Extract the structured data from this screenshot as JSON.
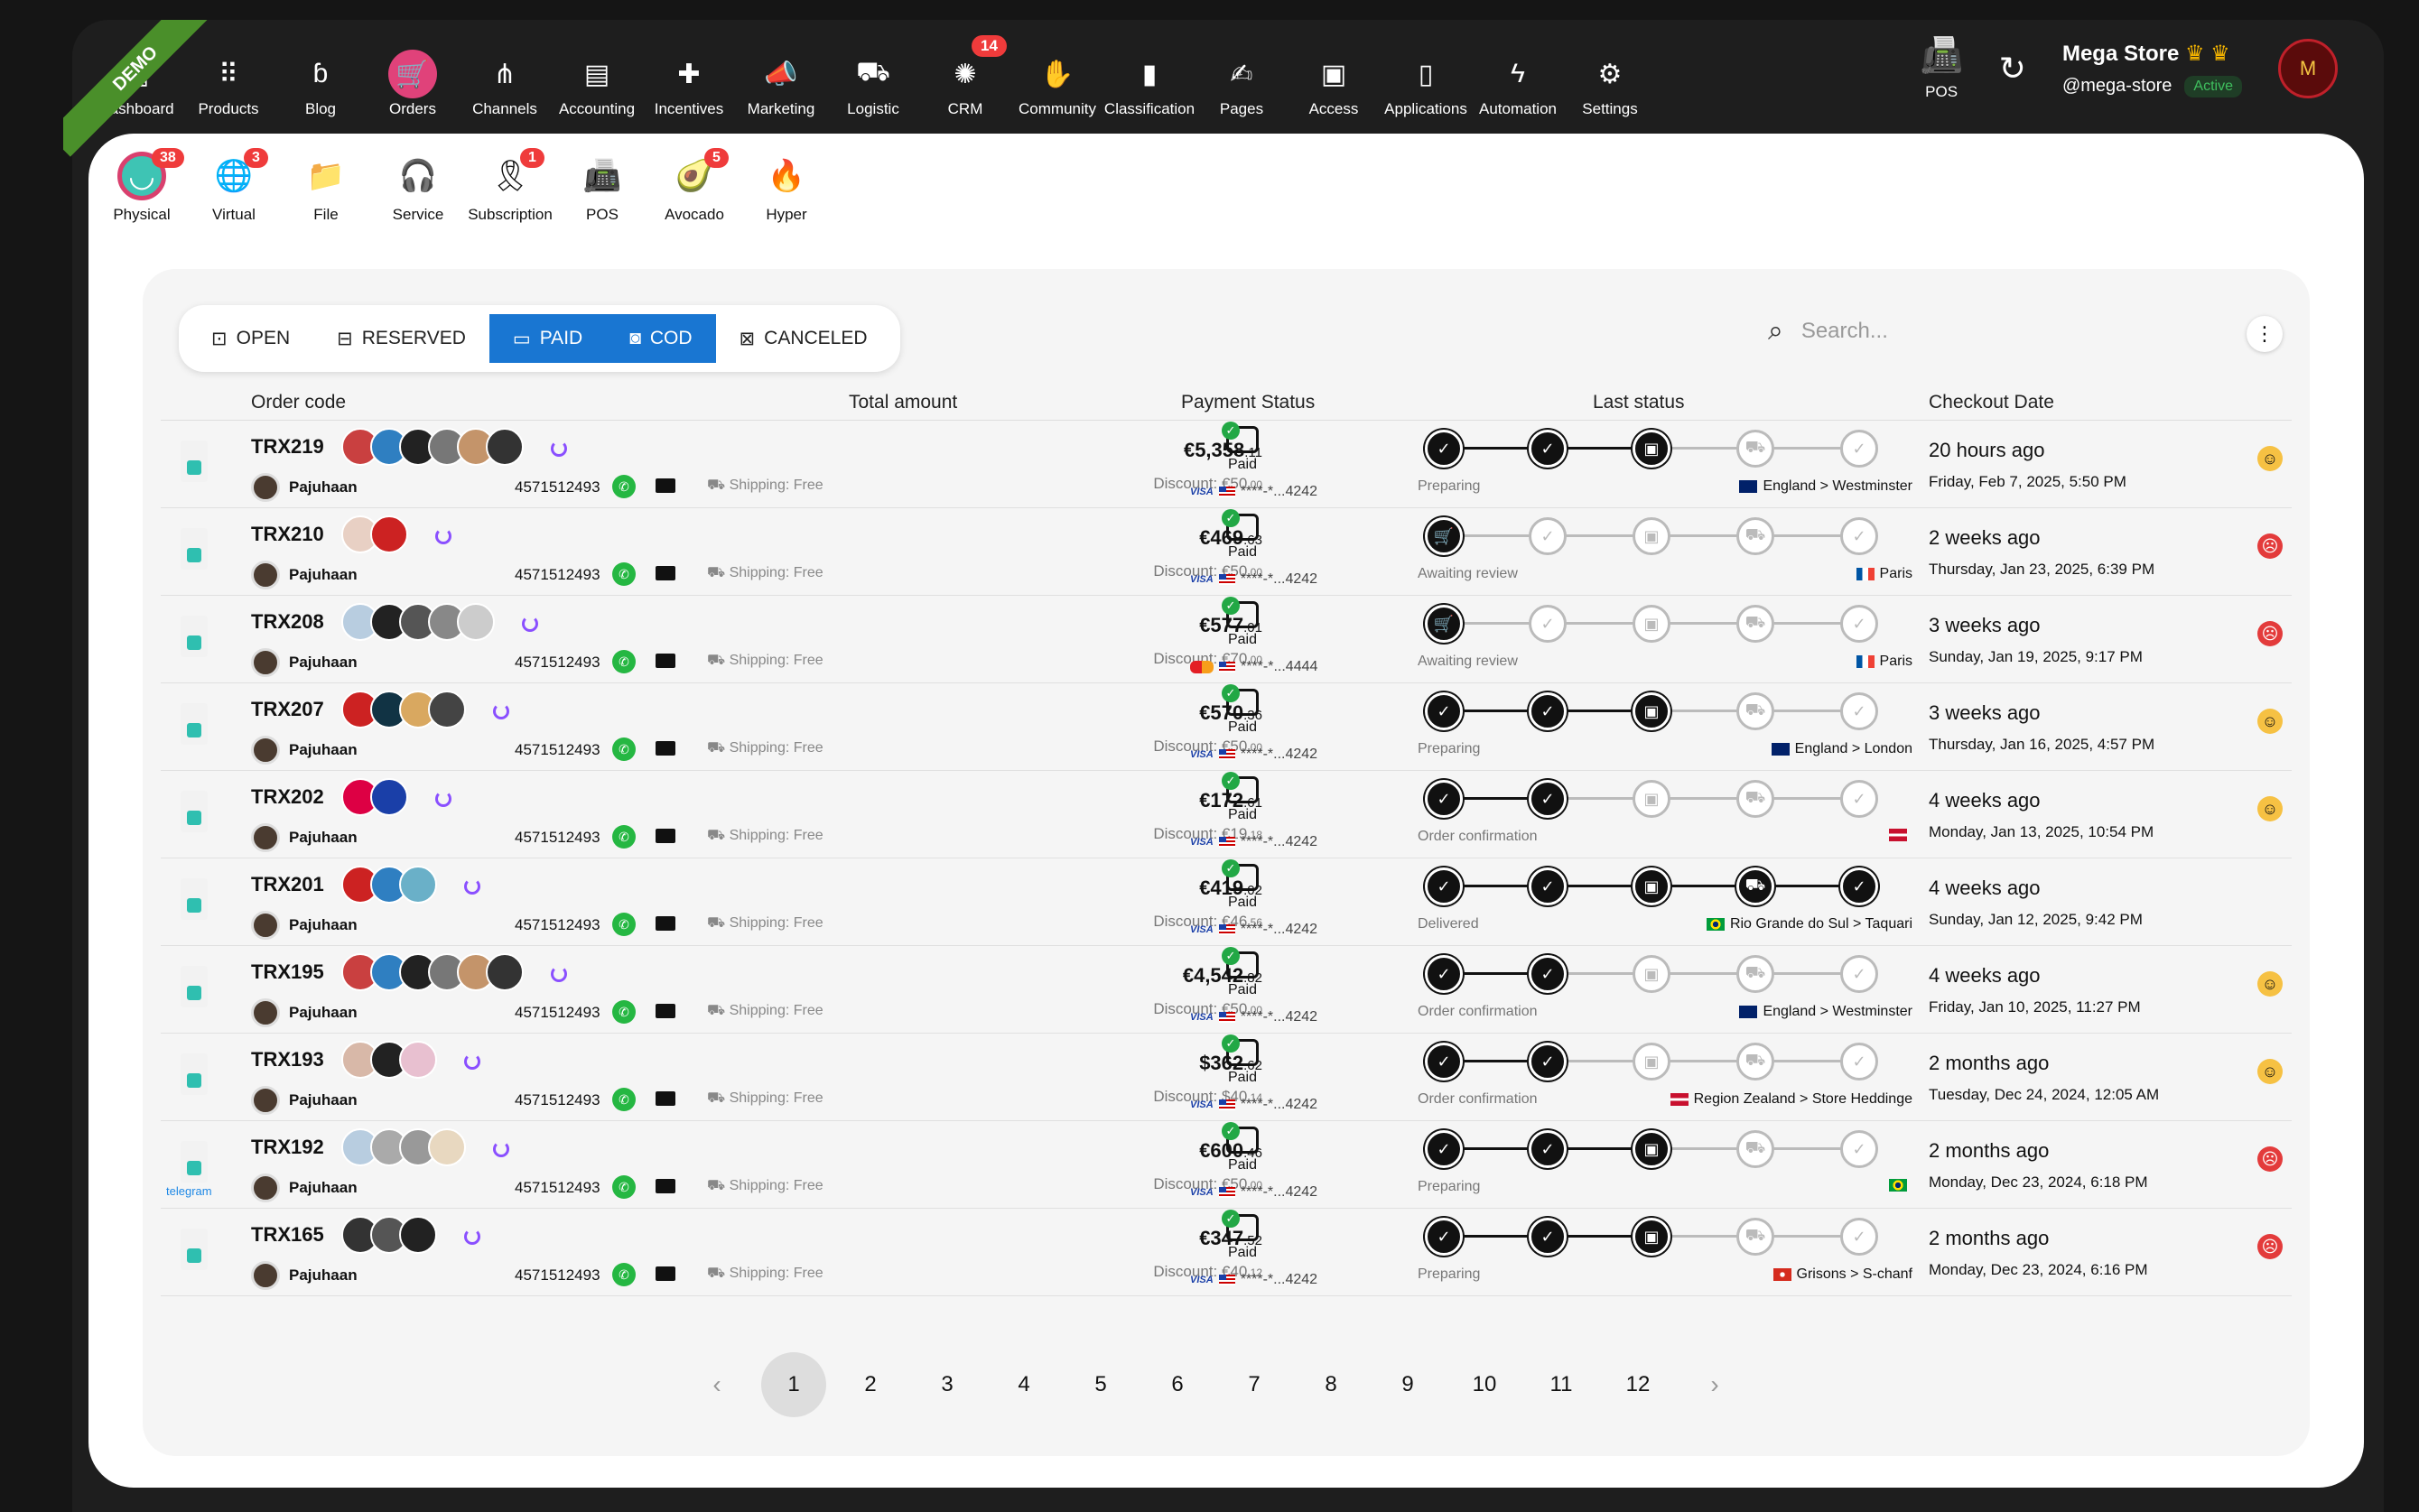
{
  "topnav": [
    {
      "label": "Dashboard",
      "icon": "dashboard-icon",
      "glyph": "▦"
    },
    {
      "label": "Products",
      "icon": "products-icon",
      "glyph": "⠿"
    },
    {
      "label": "Blog",
      "icon": "blog-icon",
      "glyph": "ɓ"
    },
    {
      "label": "Orders",
      "icon": "cart-icon",
      "glyph": "🛒",
      "active": true
    },
    {
      "label": "Channels",
      "icon": "channels-icon",
      "glyph": "⋔"
    },
    {
      "label": "Accounting",
      "icon": "register-icon",
      "glyph": "▤"
    },
    {
      "label": "Incentives",
      "icon": "ticket-icon",
      "glyph": "✚"
    },
    {
      "label": "Marketing",
      "icon": "megaphone-icon",
      "glyph": "📣"
    },
    {
      "label": "Logistic",
      "icon": "truck-icon",
      "glyph": "⛟"
    },
    {
      "label": "CRM",
      "icon": "crm-icon",
      "glyph": "✺",
      "badge": "14"
    },
    {
      "label": "Community",
      "icon": "community-icon",
      "glyph": "✋"
    },
    {
      "label": "Classification",
      "icon": "book-icon",
      "glyph": "▮"
    },
    {
      "label": "Pages",
      "icon": "pages-icon",
      "glyph": "✍"
    },
    {
      "label": "Access",
      "icon": "badge-icon",
      "glyph": "▣"
    },
    {
      "label": "Applications",
      "icon": "phone-icon",
      "glyph": "▯"
    },
    {
      "label": "Automation",
      "icon": "bolt-icon",
      "glyph": "ϟ"
    },
    {
      "label": "Settings",
      "icon": "gear-icon",
      "glyph": "⚙"
    }
  ],
  "ribbon": "DEMO",
  "right": {
    "pos_label": "POS",
    "store_name": "Mega Store",
    "handle": "@mega-store",
    "status": "Active",
    "avatar": "M"
  },
  "subnav": [
    {
      "label": "Physical",
      "icon": "bag-icon",
      "glyph": "◡",
      "badge": "38",
      "active": true
    },
    {
      "label": "Virtual",
      "icon": "globe-icon",
      "glyph": "🌐",
      "badge": "3"
    },
    {
      "label": "File",
      "icon": "folder-icon",
      "glyph": "📁"
    },
    {
      "label": "Service",
      "icon": "headset-icon",
      "glyph": "🎧"
    },
    {
      "label": "Subscription",
      "icon": "ribbon-icon",
      "glyph": "🎗",
      "badge": "1"
    },
    {
      "label": "POS",
      "icon": "pos-icon",
      "glyph": "📠"
    },
    {
      "label": "Avocado",
      "icon": "avocado-icon",
      "glyph": "🥑",
      "badge": "5"
    },
    {
      "label": "Hyper",
      "icon": "flame-icon",
      "glyph": "🔥"
    }
  ],
  "tabs": [
    {
      "label": "OPEN",
      "glyph": "⊡",
      "sel": false
    },
    {
      "label": "RESERVED",
      "glyph": "⊟",
      "sel": false
    },
    {
      "label": "PAID",
      "glyph": "▭",
      "sel": true
    },
    {
      "label": "COD",
      "glyph": "◙",
      "sel": true
    },
    {
      "label": "CANCELED",
      "glyph": "⊠",
      "sel": false
    }
  ],
  "search_placeholder": "Search...",
  "headers": {
    "code": "Order code",
    "total": "Total amount",
    "payment": "Payment Status",
    "last": "Last status",
    "date": "Checkout Date"
  },
  "colors": {
    "accent": "#1976d2",
    "orders": "#e0427a",
    "badge": "#ef3b3b"
  },
  "orders": [
    {
      "code": "TRX219",
      "thumbs": [
        "#c94040",
        "#2f7fc1",
        "#222",
        "#777",
        "#c4946a",
        "#333"
      ],
      "customer": "Pajuhaan",
      "phone": "4571512493",
      "shipping": "Shipping: Free",
      "amount": "€5,358",
      "cents": ".11",
      "discount": "Discount: €50",
      "dcents": ".00",
      "paid": "Paid",
      "card": "mc0",
      "cardtext": "****-*...4242",
      "steps": 3,
      "label": "Preparing",
      "flag": "uk",
      "loc": "England > Westminster",
      "ago": "20 hours ago",
      "date": "Friday, Feb 7, 2025, 5:50 PM",
      "face": "ok"
    },
    {
      "code": "TRX210",
      "thumbs": [
        "#e8d0c4",
        "#c22"
      ],
      "customer": "Pajuhaan",
      "phone": "4571512493",
      "shipping": "Shipping: Free",
      "amount": "€469",
      "cents": ".63",
      "discount": "Discount: €50",
      "dcents": ".00",
      "paid": "Paid",
      "card": "visa",
      "cardtext": "****-*...4242",
      "steps": 1,
      "label": "Awaiting review",
      "flag": "fr",
      "loc": "Paris",
      "ago": "2 weeks ago",
      "date": "Thursday, Jan 23, 2025, 6:39 PM",
      "face": "bad"
    },
    {
      "code": "TRX208",
      "thumbs": [
        "#b8cde0",
        "#222",
        "#555",
        "#888",
        "#ccc"
      ],
      "customer": "Pajuhaan",
      "phone": "4571512493",
      "shipping": "Shipping: Free",
      "amount": "€577",
      "cents": ".01",
      "discount": "Discount: €70",
      "dcents": ".00",
      "paid": "Paid",
      "card": "mc",
      "cardtext": "****-*...4444",
      "steps": 1,
      "label": "Awaiting review",
      "flag": "fr",
      "loc": "Paris",
      "ago": "3 weeks ago",
      "date": "Sunday, Jan 19, 2025, 9:17 PM",
      "face": "bad"
    },
    {
      "code": "TRX207",
      "thumbs": [
        "#c22",
        "#134",
        "#d9a860",
        "#444"
      ],
      "customer": "Pajuhaan",
      "phone": "4571512493",
      "shipping": "Shipping: Free",
      "amount": "€570",
      "cents": ".36",
      "discount": "Discount: €50",
      "dcents": ".00",
      "paid": "Paid",
      "card": "visa",
      "cardtext": "****-*...4242",
      "steps": 3,
      "label": "Preparing",
      "flag": "uk",
      "loc": "England > London",
      "ago": "3 weeks ago",
      "date": "Thursday, Jan 16, 2025, 4:57 PM",
      "face": "ok"
    },
    {
      "code": "TRX202",
      "thumbs": [
        "#d04",
        "#1a3fa8"
      ],
      "customer": "Pajuhaan",
      "phone": "4571512493",
      "shipping": "Shipping: Free",
      "amount": "€172",
      "cents": ".61",
      "discount": "Discount: €19",
      "dcents": ".18",
      "paid": "Paid",
      "card": "visa",
      "cardtext": "****-*...4242",
      "steps": 2,
      "label": "Order confirmation",
      "flag": "dk",
      "loc": "",
      "ago": "4 weeks ago",
      "date": "Monday, Jan 13, 2025, 10:54 PM",
      "face": "ok"
    },
    {
      "code": "TRX201",
      "thumbs": [
        "#c22",
        "#2f7fc1",
        "#6ab0c8"
      ],
      "customer": "Pajuhaan",
      "phone": "4571512493",
      "shipping": "Shipping: Free",
      "amount": "€419",
      "cents": ".02",
      "discount": "Discount: €46",
      "dcents": ".56",
      "paid": "Paid",
      "card": "visa",
      "cardtext": "****-*...4242",
      "steps": 5,
      "label": "Delivered",
      "flag": "br",
      "loc": "Rio Grande do Sul > Taquari",
      "ago": "4 weeks ago",
      "date": "Sunday, Jan 12, 2025, 9:42 PM",
      "face": "none"
    },
    {
      "code": "TRX195",
      "thumbs": [
        "#c94040",
        "#2f7fc1",
        "#222",
        "#777",
        "#c4946a",
        "#333"
      ],
      "customer": "Pajuhaan",
      "phone": "4571512493",
      "shipping": "Shipping: Free",
      "amount": "€4,542",
      "cents": ".82",
      "discount": "Discount: €50",
      "dcents": ".00",
      "paid": "Paid",
      "card": "visa",
      "cardtext": "****-*...4242",
      "steps": 2,
      "label": "Order confirmation",
      "flag": "uk",
      "loc": "England > Westminster",
      "ago": "4 weeks ago",
      "date": "Friday, Jan 10, 2025, 11:27 PM",
      "face": "ok"
    },
    {
      "code": "TRX193",
      "thumbs": [
        "#d8b8a8",
        "#222",
        "#e8c0d0"
      ],
      "customer": "Pajuhaan",
      "phone": "4571512493",
      "shipping": "Shipping: Free",
      "amount": "$362",
      "cents": ".62",
      "discount": "Discount: $40",
      "dcents": ".14",
      "paid": "Paid",
      "card": "visa",
      "cardtext": "****-*...4242",
      "steps": 2,
      "label": "Order confirmation",
      "flag": "dk",
      "loc": "Region Zealand > Store Heddinge",
      "ago": "2 months ago",
      "date": "Tuesday, Dec 24, 2024, 12:05 AM",
      "face": "ok"
    },
    {
      "code": "TRX192",
      "thumbs": [
        "#b8cde0",
        "#aaa",
        "#999",
        "#e8d8c0"
      ],
      "customer": "Pajuhaan",
      "phone": "4571512493",
      "shipping": "Shipping: Free",
      "amount": "€600",
      "cents": ".46",
      "discount": "Discount: €50",
      "dcents": ".00",
      "paid": "Paid",
      "card": "visa",
      "cardtext": "****-*...4242",
      "steps": 3,
      "label": "Preparing",
      "flag": "br",
      "loc": "",
      "ago": "2 months ago",
      "date": "Monday, Dec 23, 2024, 6:18 PM",
      "face": "bad",
      "telegram": "telegram"
    },
    {
      "code": "TRX165",
      "thumbs": [
        "#333",
        "#555",
        "#222"
      ],
      "customer": "Pajuhaan",
      "phone": "4571512493",
      "shipping": "Shipping: Free",
      "amount": "€347",
      "cents": ".52",
      "discount": "Discount: €40",
      "dcents": ".12",
      "paid": "Paid",
      "card": "visa",
      "cardtext": "****-*...4242",
      "steps": 3,
      "label": "Preparing",
      "flag": "ch",
      "loc": "Grisons > S-chanf",
      "ago": "2 months ago",
      "date": "Monday, Dec 23, 2024, 6:16 PM",
      "face": "bad"
    }
  ],
  "pages": [
    "1",
    "2",
    "3",
    "4",
    "5",
    "6",
    "7",
    "8",
    "9",
    "10",
    "11",
    "12"
  ],
  "current_page": "1"
}
